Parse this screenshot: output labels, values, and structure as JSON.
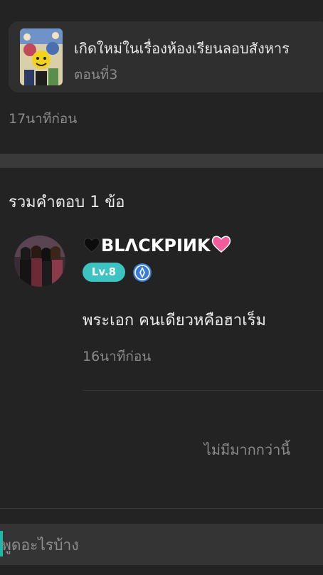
{
  "story_card": {
    "title": "เกิดใหม่ในเรื่องห้องเรียนลอบสังหาร",
    "episode": "ตอนที่3"
  },
  "post_time": "17นาทีก่อน",
  "answers_header": "รวมคำตอบ 1 ข้อ",
  "reply": {
    "username_prefix": "❤",
    "username": "BLΛCKPIИK",
    "username_suffix": "💗",
    "level": "Lv.8",
    "text": "พระเอก คนเดียวหคือฮาเร็ม",
    "time": "16นาทีก่อน"
  },
  "no_more": "ไม่มีมากกว่านี้",
  "input": {
    "placeholder": "พูดอะไรบ้าง"
  },
  "colors": {
    "background": "#232323",
    "card": "#2f2f2f",
    "level_badge": "#3ec3c3",
    "caret": "#1fb8a8",
    "verified_badge": "#3a7bd5"
  }
}
